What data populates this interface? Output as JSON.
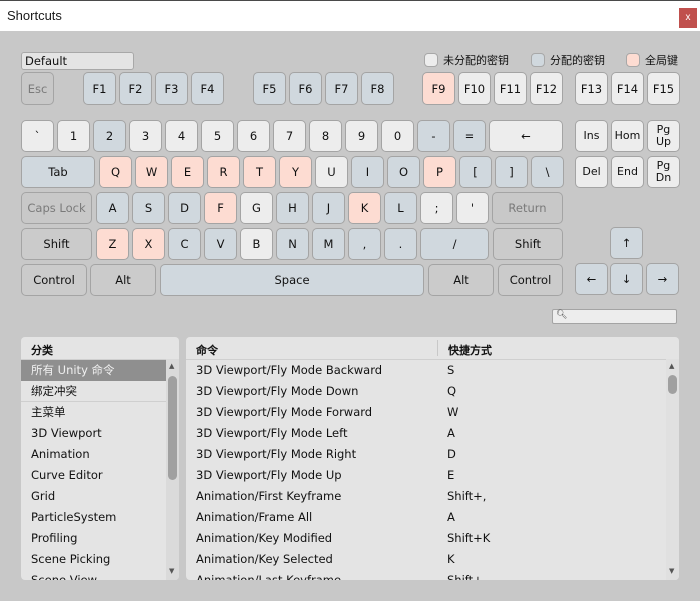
{
  "window": {
    "title": "Shortcuts",
    "close_label": "x"
  },
  "profile": {
    "value": "Default"
  },
  "legend": [
    {
      "label": "未分配的密钥",
      "color": "#ededed"
    },
    {
      "label": "分配的密钥",
      "color": "#d0d8de"
    },
    {
      "label": "全局键",
      "color": "#fddcd2"
    }
  ],
  "keyboard": {
    "row_fn": [
      {
        "label": "Esc",
        "state": "dis"
      },
      {
        "label": "F1",
        "state": "a"
      },
      {
        "label": "F2",
        "state": "a"
      },
      {
        "label": "F3",
        "state": "a"
      },
      {
        "label": "F4",
        "state": "a"
      },
      {
        "label": "F5",
        "state": "a"
      },
      {
        "label": "F6",
        "state": "a"
      },
      {
        "label": "F7",
        "state": "a"
      },
      {
        "label": "F8",
        "state": "a"
      },
      {
        "label": "F9",
        "state": "g"
      },
      {
        "label": "F10",
        "state": "u"
      },
      {
        "label": "F11",
        "state": "u"
      },
      {
        "label": "F12",
        "state": "u"
      },
      {
        "label": "F13",
        "state": "u"
      },
      {
        "label": "F14",
        "state": "u"
      },
      {
        "label": "F15",
        "state": "u"
      }
    ],
    "row_num": [
      {
        "label": "`",
        "state": "u"
      },
      {
        "label": "1",
        "state": "u"
      },
      {
        "label": "2",
        "state": "a"
      },
      {
        "label": "3",
        "state": "u"
      },
      {
        "label": "4",
        "state": "u"
      },
      {
        "label": "5",
        "state": "u"
      },
      {
        "label": "6",
        "state": "u"
      },
      {
        "label": "7",
        "state": "u"
      },
      {
        "label": "8",
        "state": "u"
      },
      {
        "label": "9",
        "state": "u"
      },
      {
        "label": "0",
        "state": "u"
      },
      {
        "label": "-",
        "state": "a"
      },
      {
        "label": "=",
        "state": "a"
      },
      {
        "label": "←",
        "state": "u"
      }
    ],
    "row_q": [
      {
        "label": "Tab",
        "state": "a"
      },
      {
        "label": "Q",
        "state": "g"
      },
      {
        "label": "W",
        "state": "g"
      },
      {
        "label": "E",
        "state": "g"
      },
      {
        "label": "R",
        "state": "g"
      },
      {
        "label": "T",
        "state": "g"
      },
      {
        "label": "Y",
        "state": "g"
      },
      {
        "label": "U",
        "state": "u"
      },
      {
        "label": "I",
        "state": "a"
      },
      {
        "label": "O",
        "state": "a"
      },
      {
        "label": "P",
        "state": "g"
      },
      {
        "label": "[",
        "state": "a"
      },
      {
        "label": "]",
        "state": "a"
      },
      {
        "label": "\\",
        "state": "a"
      }
    ],
    "row_a": [
      {
        "label": "Caps Lock",
        "state": "dis"
      },
      {
        "label": "A",
        "state": "a"
      },
      {
        "label": "S",
        "state": "a"
      },
      {
        "label": "D",
        "state": "a"
      },
      {
        "label": "F",
        "state": "g"
      },
      {
        "label": "G",
        "state": "u"
      },
      {
        "label": "H",
        "state": "a"
      },
      {
        "label": "J",
        "state": "a"
      },
      {
        "label": "K",
        "state": "g"
      },
      {
        "label": "L",
        "state": "a"
      },
      {
        "label": ";",
        "state": "u"
      },
      {
        "label": "'",
        "state": "u"
      },
      {
        "label": "Return",
        "state": "dis"
      }
    ],
    "row_z": [
      {
        "label": "Shift",
        "state": "m"
      },
      {
        "label": "Z",
        "state": "g"
      },
      {
        "label": "X",
        "state": "g"
      },
      {
        "label": "C",
        "state": "a"
      },
      {
        "label": "V",
        "state": "a"
      },
      {
        "label": "B",
        "state": "u"
      },
      {
        "label": "N",
        "state": "a"
      },
      {
        "label": "M",
        "state": "a"
      },
      {
        "label": ",",
        "state": "a"
      },
      {
        "label": ".",
        "state": "a"
      },
      {
        "label": "/",
        "state": "a"
      },
      {
        "label": "Shift",
        "state": "m"
      }
    ],
    "row_space": [
      {
        "label": "Control",
        "state": "m"
      },
      {
        "label": "Alt",
        "state": "m"
      },
      {
        "label": "Space",
        "state": "a"
      },
      {
        "label": "Alt",
        "state": "m"
      },
      {
        "label": "Control",
        "state": "m"
      }
    ],
    "nav": [
      {
        "label": "Ins",
        "state": "u"
      },
      {
        "label": "Hom",
        "state": "u"
      },
      {
        "label": "Pg\nUp",
        "state": "u"
      },
      {
        "label": "Del",
        "state": "u"
      },
      {
        "label": "End",
        "state": "u"
      },
      {
        "label": "Pg\nDn",
        "state": "u"
      }
    ],
    "arrows": [
      {
        "label": "↑",
        "state": "a"
      },
      {
        "label": "←",
        "state": "a"
      },
      {
        "label": "↓",
        "state": "a"
      },
      {
        "label": "→",
        "state": "a"
      }
    ]
  },
  "search": {
    "value": "",
    "icon": "search-icon"
  },
  "categories": {
    "header": "分类",
    "items": [
      "所有 Unity 命令",
      "绑定冲突",
      "主菜单",
      "3D Viewport",
      "Animation",
      "Curve Editor",
      "Grid",
      "ParticleSystem",
      "Profiling",
      "Scene Picking",
      "Scene View"
    ],
    "selected_index": 0
  },
  "commands": {
    "header_command": "命令",
    "header_shortcut": "快捷方式",
    "rows": [
      {
        "command": "3D Viewport/Fly Mode Backward",
        "shortcut": "S"
      },
      {
        "command": "3D Viewport/Fly Mode Down",
        "shortcut": "Q"
      },
      {
        "command": "3D Viewport/Fly Mode Forward",
        "shortcut": "W"
      },
      {
        "command": "3D Viewport/Fly Mode Left",
        "shortcut": "A"
      },
      {
        "command": "3D Viewport/Fly Mode Right",
        "shortcut": "D"
      },
      {
        "command": "3D Viewport/Fly Mode Up",
        "shortcut": "E"
      },
      {
        "command": "Animation/First Keyframe",
        "shortcut": "Shift+,"
      },
      {
        "command": "Animation/Frame All",
        "shortcut": "A"
      },
      {
        "command": "Animation/Key Modified",
        "shortcut": "Shift+K"
      },
      {
        "command": "Animation/Key Selected",
        "shortcut": "K"
      },
      {
        "command": "Animation/Last Keyframe",
        "shortcut": "Shift+."
      }
    ]
  }
}
